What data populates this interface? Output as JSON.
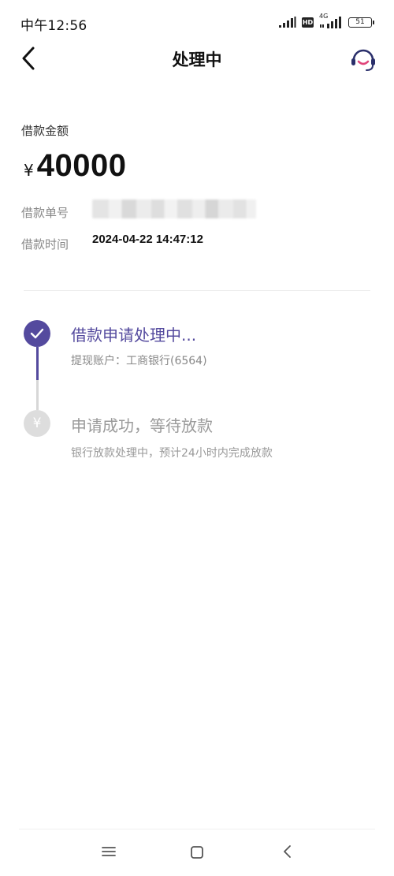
{
  "status_bar": {
    "time": "中午12:56",
    "hd_label": "HD",
    "network_label": "4G",
    "battery": "51"
  },
  "header": {
    "title": "处理中",
    "back_icon": "chevron-left-icon",
    "support_icon": "headset-icon"
  },
  "loan": {
    "amount_label": "借款金额",
    "currency": "¥",
    "amount": "40000",
    "order_label": "借款单号",
    "time_label": "借款时间",
    "time_value": "2024-04-22 14:47:12"
  },
  "timeline": [
    {
      "title": "借款申请处理中...",
      "subtitle": "提现账户：工商银行(6564)",
      "status": "active",
      "icon": "check-icon"
    },
    {
      "title": "申请成功，等待放款",
      "subtitle": "银行放款处理中，预计24小时内完成放款",
      "status": "pending",
      "icon": "yen-icon",
      "icon_glyph": "¥"
    }
  ],
  "colors": {
    "accent": "#544a9e",
    "inactive": "#dddddd"
  },
  "system_nav": [
    "menu-icon",
    "home-icon",
    "back-icon"
  ]
}
